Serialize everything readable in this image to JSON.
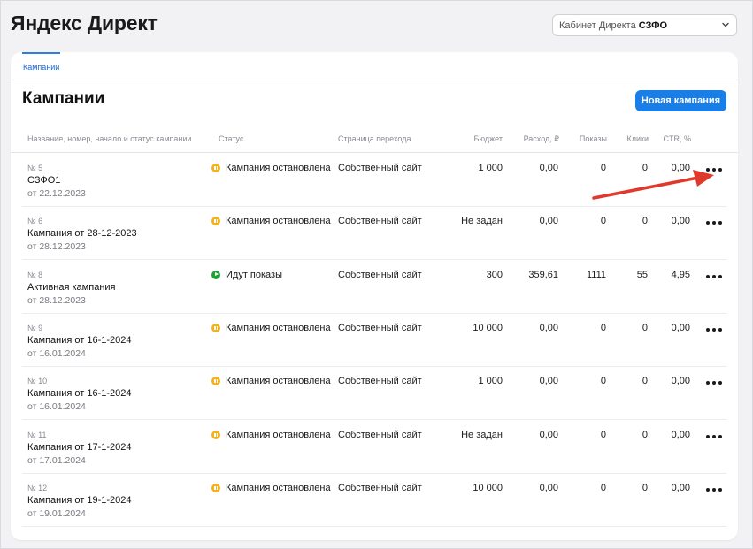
{
  "app": {
    "title": "Яндекс Директ"
  },
  "cabinet": {
    "prefix": "Кабинет Директа",
    "name": "СЗФО",
    "chevron_icon": "chevron-down-icon"
  },
  "tabs": [
    {
      "label": "Кампании",
      "active": true
    }
  ],
  "page": {
    "title": "Кампании",
    "new_campaign_label": "Новая кампания"
  },
  "colors": {
    "accent": "#1a7ee8",
    "paused": "#f3b11e",
    "running": "#21a038",
    "annotation_arrow": "#e0392b"
  },
  "table": {
    "headers": {
      "name": "Название, номер, начало и статус кампании",
      "status": "Статус",
      "page": "Страница перехода",
      "budget": "Бюджет",
      "spend": "Расход, ₽",
      "impressions": "Показы",
      "clicks": "Клики",
      "ctr": "CTR, %"
    },
    "rows": [
      {
        "number": "№ 5",
        "name": "СЗФО1",
        "date": "от 22.12.2023",
        "status": "Кампания остановлена",
        "status_icon": "pause-icon",
        "page": "Собственный сайт",
        "budget": "1 000",
        "spend": "0,00",
        "impressions": "0",
        "clicks": "0",
        "ctr": "0,00"
      },
      {
        "number": "№ 6",
        "name": "Кампания от 28-12-2023",
        "date": "от 28.12.2023",
        "status": "Кампания остановлена",
        "status_icon": "pause-icon",
        "page": "Собственный сайт",
        "budget": "Не задан",
        "spend": "0,00",
        "impressions": "0",
        "clicks": "0",
        "ctr": "0,00"
      },
      {
        "number": "№ 8",
        "name": "Активная кампания",
        "date": "от 28.12.2023",
        "status": "Идут показы",
        "status_icon": "play-icon",
        "page": "Собственный сайт",
        "budget": "300",
        "spend": "359,61",
        "impressions": "1111",
        "clicks": "55",
        "ctr": "4,95"
      },
      {
        "number": "№ 9",
        "name": "Кампания от 16-1-2024",
        "date": "от 16.01.2024",
        "status": "Кампания остановлена",
        "status_icon": "pause-icon",
        "page": "Собственный сайт",
        "budget": "10 000",
        "spend": "0,00",
        "impressions": "0",
        "clicks": "0",
        "ctr": "0,00"
      },
      {
        "number": "№ 10",
        "name": "Кампания от 16-1-2024",
        "date": "от 16.01.2024",
        "status": "Кампания остановлена",
        "status_icon": "pause-icon",
        "page": "Собственный сайт",
        "budget": "1 000",
        "spend": "0,00",
        "impressions": "0",
        "clicks": "0",
        "ctr": "0,00"
      },
      {
        "number": "№ 11",
        "name": "Кампания от 17-1-2024",
        "date": "от 17.01.2024",
        "status": "Кампания остановлена",
        "status_icon": "pause-icon",
        "page": "Собственный сайт",
        "budget": "Не задан",
        "spend": "0,00",
        "impressions": "0",
        "clicks": "0",
        "ctr": "0,00"
      },
      {
        "number": "№ 12",
        "name": "Кампания от 19-1-2024",
        "date": "от 19.01.2024",
        "status": "Кампания остановлена",
        "status_icon": "pause-icon",
        "page": "Собственный сайт",
        "budget": "10 000",
        "spend": "0,00",
        "impressions": "0",
        "clicks": "0",
        "ctr": "0,00"
      }
    ],
    "row_menu_icon": "more-dots-icon"
  }
}
